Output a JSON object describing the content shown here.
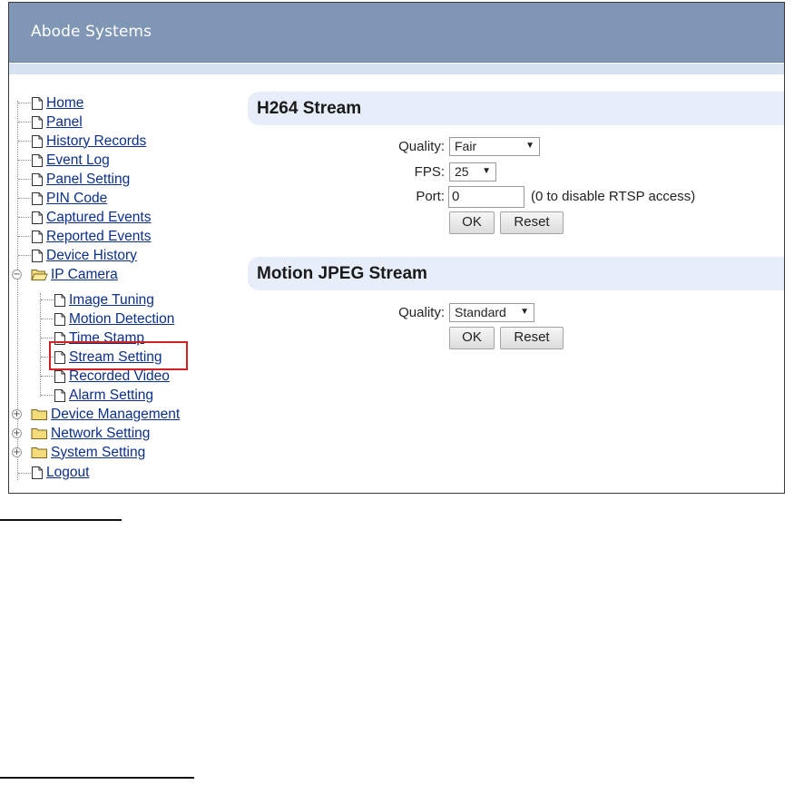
{
  "app": {
    "title": "Abode Systems"
  },
  "nav": {
    "items": [
      {
        "label": "Home"
      },
      {
        "label": "Panel"
      },
      {
        "label": "History Records"
      },
      {
        "label": "Event Log"
      },
      {
        "label": "Panel Setting"
      },
      {
        "label": "PIN Code"
      },
      {
        "label": "Captured Events"
      },
      {
        "label": "Reported Events"
      },
      {
        "label": "Device History"
      },
      {
        "label": "IP Camera"
      },
      {
        "label": "Image Tuning"
      },
      {
        "label": "Motion Detection"
      },
      {
        "label": "Time Stamp"
      },
      {
        "label": "Stream Setting"
      },
      {
        "label": "Recorded Video"
      },
      {
        "label": "Alarm Setting"
      },
      {
        "label": "Device Management"
      },
      {
        "label": "Network Setting"
      },
      {
        "label": "System Setting"
      },
      {
        "label": "Logout"
      }
    ],
    "selected": "Stream Setting"
  },
  "h264": {
    "title": "H264 Stream",
    "quality_label": "Quality:",
    "quality_value": "Fair",
    "fps_label": "FPS:",
    "fps_value": "25",
    "port_label": "Port:",
    "port_value": "0",
    "port_hint": "(0 to disable RTSP access)",
    "ok_label": "OK",
    "reset_label": "Reset"
  },
  "mjpeg": {
    "title": "Motion JPEG Stream",
    "quality_label": "Quality:",
    "quality_value": "Standard",
    "ok_label": "OK",
    "reset_label": "Reset"
  },
  "colors": {
    "header": "#7f97b4",
    "section_bar": "#e7eef9",
    "link": "#0b2f8a",
    "highlight": "#d32222"
  },
  "icons": {
    "page": "document-icon",
    "folder": "folder-icon",
    "expand": "plus-icon",
    "collapse": "minus-icon",
    "dropdown": "caret-down-icon"
  }
}
